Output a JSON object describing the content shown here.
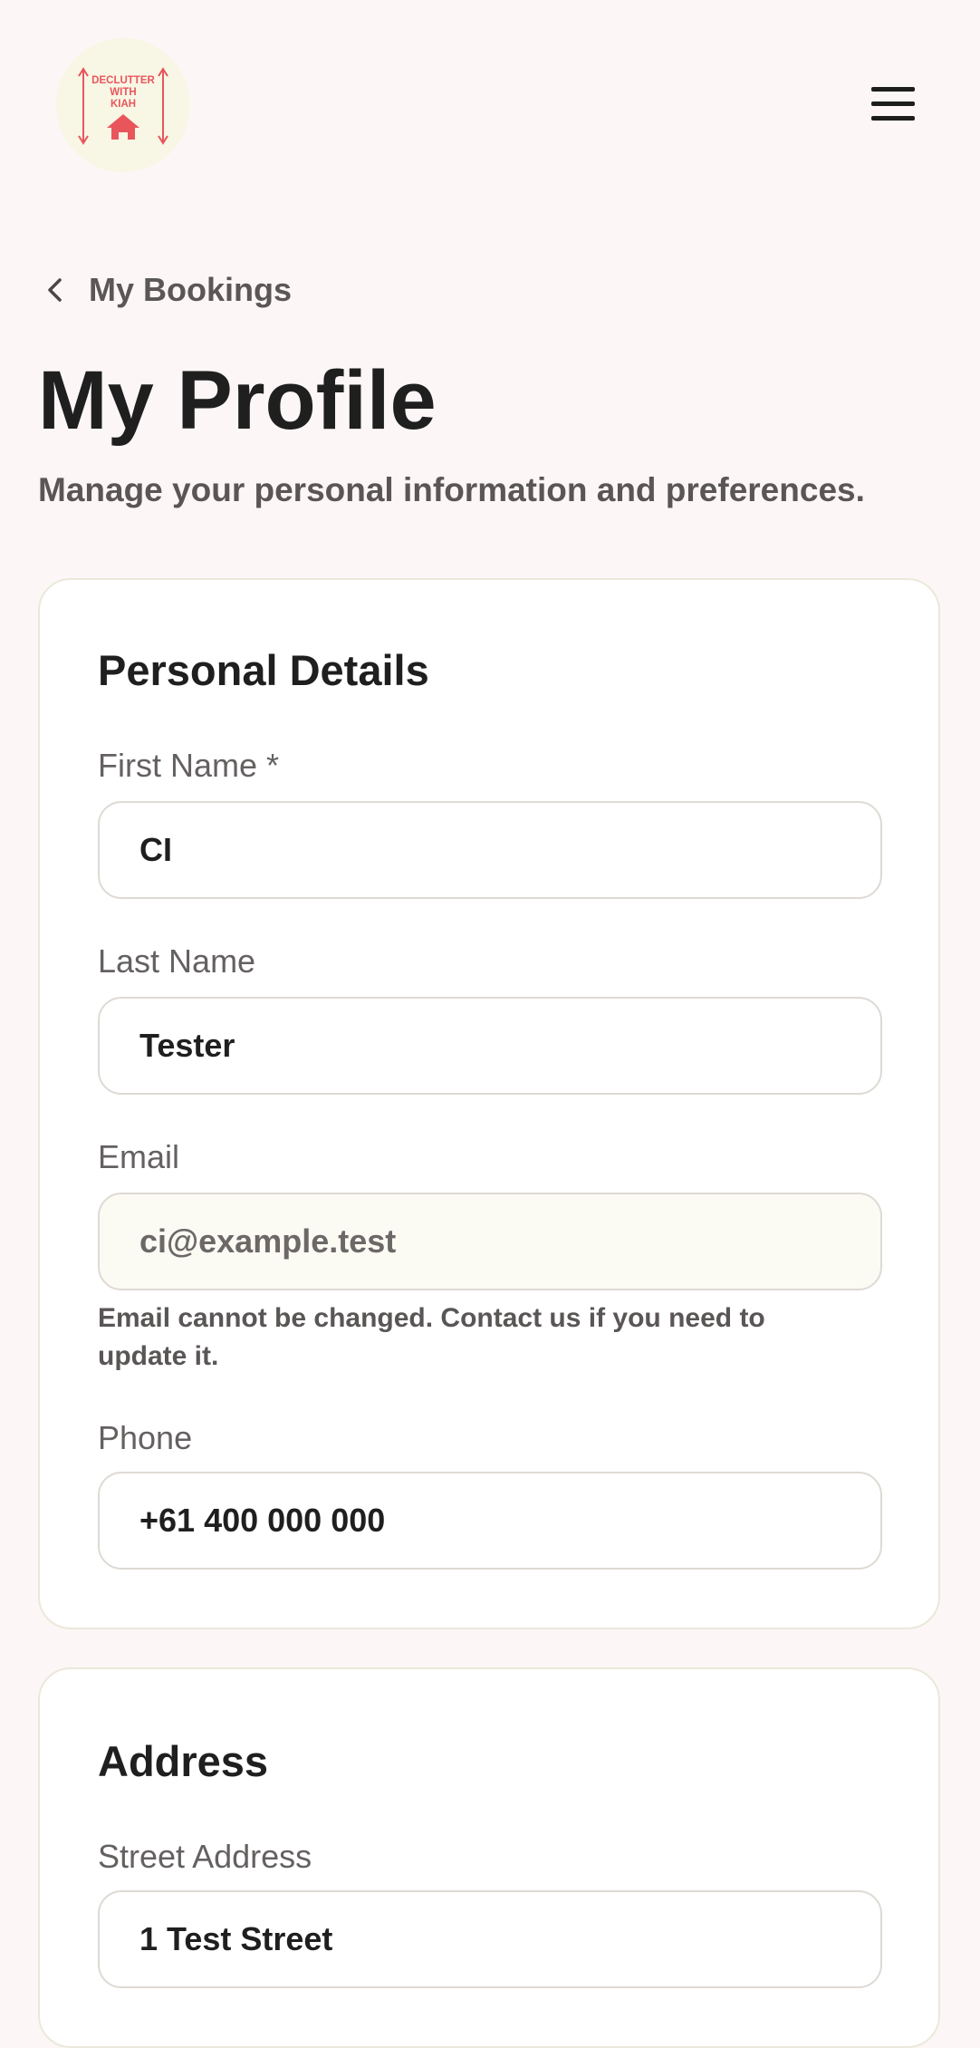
{
  "brand": {
    "logo_lines": [
      "DECLUTTER",
      "WITH",
      "KIAH"
    ],
    "accent_color": "#e8565c"
  },
  "header": {
    "menu_icon": "hamburger-icon"
  },
  "nav": {
    "back_label": "My Bookings",
    "back_icon": "chevron-left-icon"
  },
  "page": {
    "title": "My Profile",
    "subtitle": "Manage your personal information and preferences."
  },
  "personal_details": {
    "title": "Personal Details",
    "first_name": {
      "label": "First Name *",
      "value": "CI"
    },
    "last_name": {
      "label": "Last Name",
      "value": "Tester"
    },
    "email": {
      "label": "Email",
      "value": "ci@example.test",
      "helper": "Email cannot be changed. Contact us if you need to update it."
    },
    "phone": {
      "label": "Phone",
      "value": "+61 400 000 000"
    }
  },
  "address": {
    "title": "Address",
    "street": {
      "label": "Street Address",
      "value": "1 Test Street"
    }
  }
}
